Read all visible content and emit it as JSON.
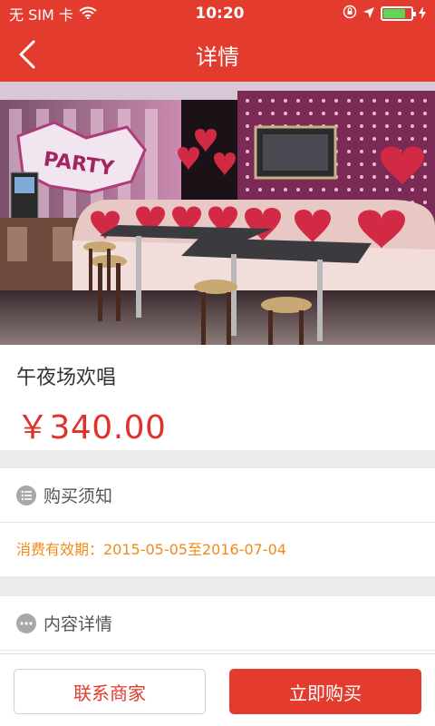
{
  "status_bar": {
    "carrier": "无 SIM 卡",
    "time": "10:20",
    "battery_level": 0.8
  },
  "nav": {
    "title": "详情",
    "back_icon": "chevron-left-icon"
  },
  "product": {
    "name": "午夜场欢唱",
    "price": "￥340.00",
    "image_sign": "PARTY"
  },
  "purchase_notice": {
    "heading": "购买须知",
    "validity": "消费有效期：2015-05-05至2016-07-04"
  },
  "content_details": {
    "heading": "内容详情"
  },
  "actions": {
    "contact_label": "联系商家",
    "buy_label": "立即购买"
  },
  "colors": {
    "brand": "#e33b2e",
    "validity_text": "#f08a1c"
  }
}
